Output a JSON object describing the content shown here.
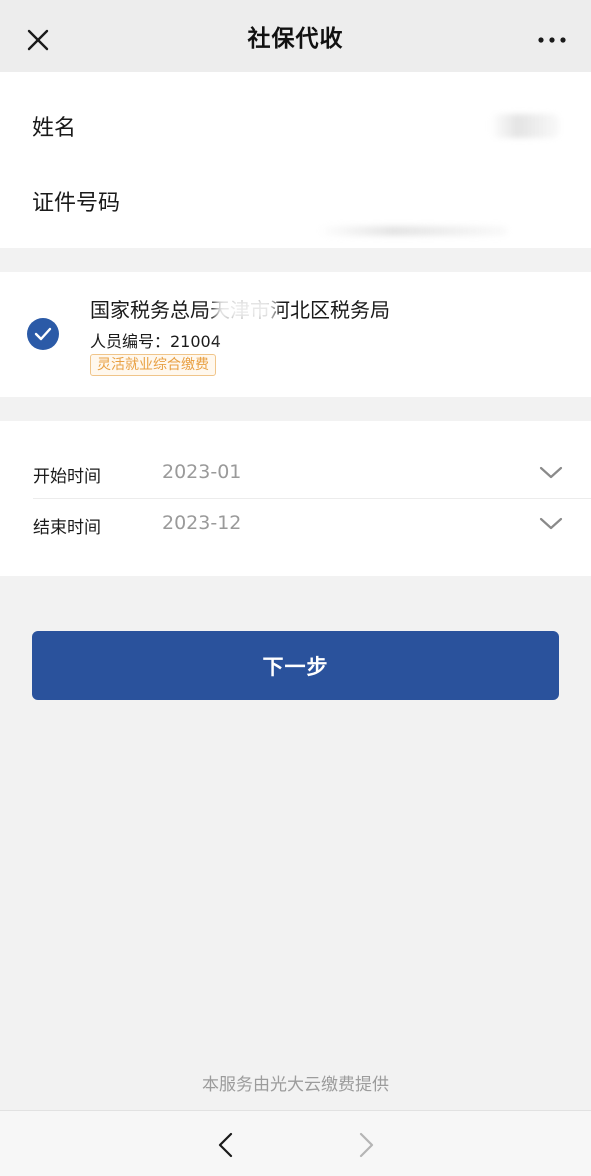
{
  "navbar": {
    "title": "社保代收",
    "close_icon": "close-icon",
    "more_icon": "more-icon"
  },
  "identity": {
    "name_label": "姓名",
    "id_label": "证件号码"
  },
  "bureau": {
    "name": "国家税务总局天津市河北区税务局",
    "person_id": "人员编号：21004",
    "tag": "灵活就业综合缴费",
    "selected": true,
    "check_icon": "check-circle-icon",
    "accent": "#2b5aa7"
  },
  "dates": {
    "start_label": "开始时间",
    "start_value": "2023-01",
    "end_label": "结束时间",
    "end_value": "2023-12",
    "chevron_icon": "chevron-down-icon"
  },
  "actions": {
    "next_label": "下一步",
    "button_color": "#2a529c"
  },
  "footer": {
    "provider": "本服务由光大云缴费提供",
    "back_icon": "back-arrow-icon",
    "forward_icon": "forward-arrow-icon"
  }
}
